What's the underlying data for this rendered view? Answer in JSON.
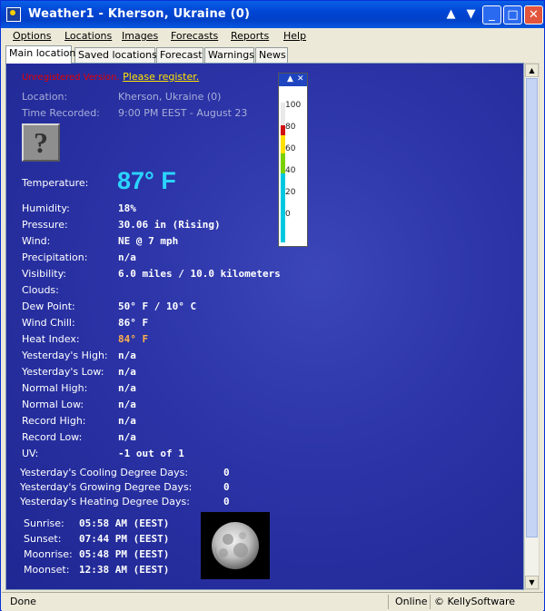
{
  "window": {
    "title": "Weather1 - Kherson, Ukraine (0)"
  },
  "menu": [
    "Options",
    "Locations",
    "Images",
    "Forecasts",
    "Reports",
    "Help"
  ],
  "tabs": [
    "Main location",
    "Saved locations",
    "Forecast",
    "Warnings",
    "News"
  ],
  "notice": {
    "unregistered": "Unregistered Version.",
    "register_link": "Please register."
  },
  "header": {
    "location_label": "Location:",
    "location_value": "Kherson, Ukraine (0)",
    "time_label": "Time Recorded:",
    "time_value": "9:00 PM EEST - August 23"
  },
  "icons": {
    "condition": "question-mark-icon"
  },
  "temperature": {
    "label": "Temperature:",
    "value": "87° F"
  },
  "rows": [
    {
      "label": "Humidity:",
      "value": "18%"
    },
    {
      "label": "Pressure:",
      "value": "30.06 in (Rising)"
    },
    {
      "label": "Wind:",
      "value": "NE @ 7 mph"
    },
    {
      "label": "Precipitation:",
      "value": "n/a"
    },
    {
      "label": "Visibility:",
      "value": "6.0 miles / 10.0 kilometers"
    },
    {
      "label": "Clouds:",
      "value": ""
    },
    {
      "label": "Dew Point:",
      "value": "50° F / 10° C"
    },
    {
      "label": "Wind Chill:",
      "value": "86° F"
    },
    {
      "label": "Heat Index:",
      "value": "84° F"
    },
    {
      "label": "Yesterday's High:",
      "value": "n/a"
    },
    {
      "label": "Yesterday's Low:",
      "value": "n/a"
    },
    {
      "label": "Normal High:",
      "value": "n/a"
    },
    {
      "label": "Normal Low:",
      "value": "n/a"
    },
    {
      "label": "Record High:",
      "value": "n/a"
    },
    {
      "label": "Record Low:",
      "value": "n/a"
    },
    {
      "label": "UV:",
      "value": "-1 out of 1"
    }
  ],
  "degree_days": [
    {
      "label": "Yesterday's Cooling Degree Days:",
      "value": "0"
    },
    {
      "label": "Yesterday's Growing Degree Days:",
      "value": "0"
    },
    {
      "label": "Yesterday's Heating Degree Days:",
      "value": "0"
    }
  ],
  "astro": [
    {
      "label": "Sunrise:",
      "value": "05:58 AM (EEST)"
    },
    {
      "label": "Sunset:",
      "value": "07:44 PM (EEST)"
    },
    {
      "label": "Moonrise:",
      "value": "05:48 PM (EEST)"
    },
    {
      "label": "Moonset:",
      "value": "12:38 AM (EEST)"
    }
  ],
  "thermometer": {
    "ticks": [
      "100",
      "80",
      "60",
      "40",
      "20",
      "0"
    ],
    "reading": 87
  },
  "status": {
    "left": "Done",
    "online": "Online",
    "copyright": "© KellySoftware"
  },
  "colors": {
    "accent_temp": "#2ad4ff",
    "heat_index": "#ffb04a",
    "unregistered": "#e60000",
    "register": "#ffe400"
  }
}
